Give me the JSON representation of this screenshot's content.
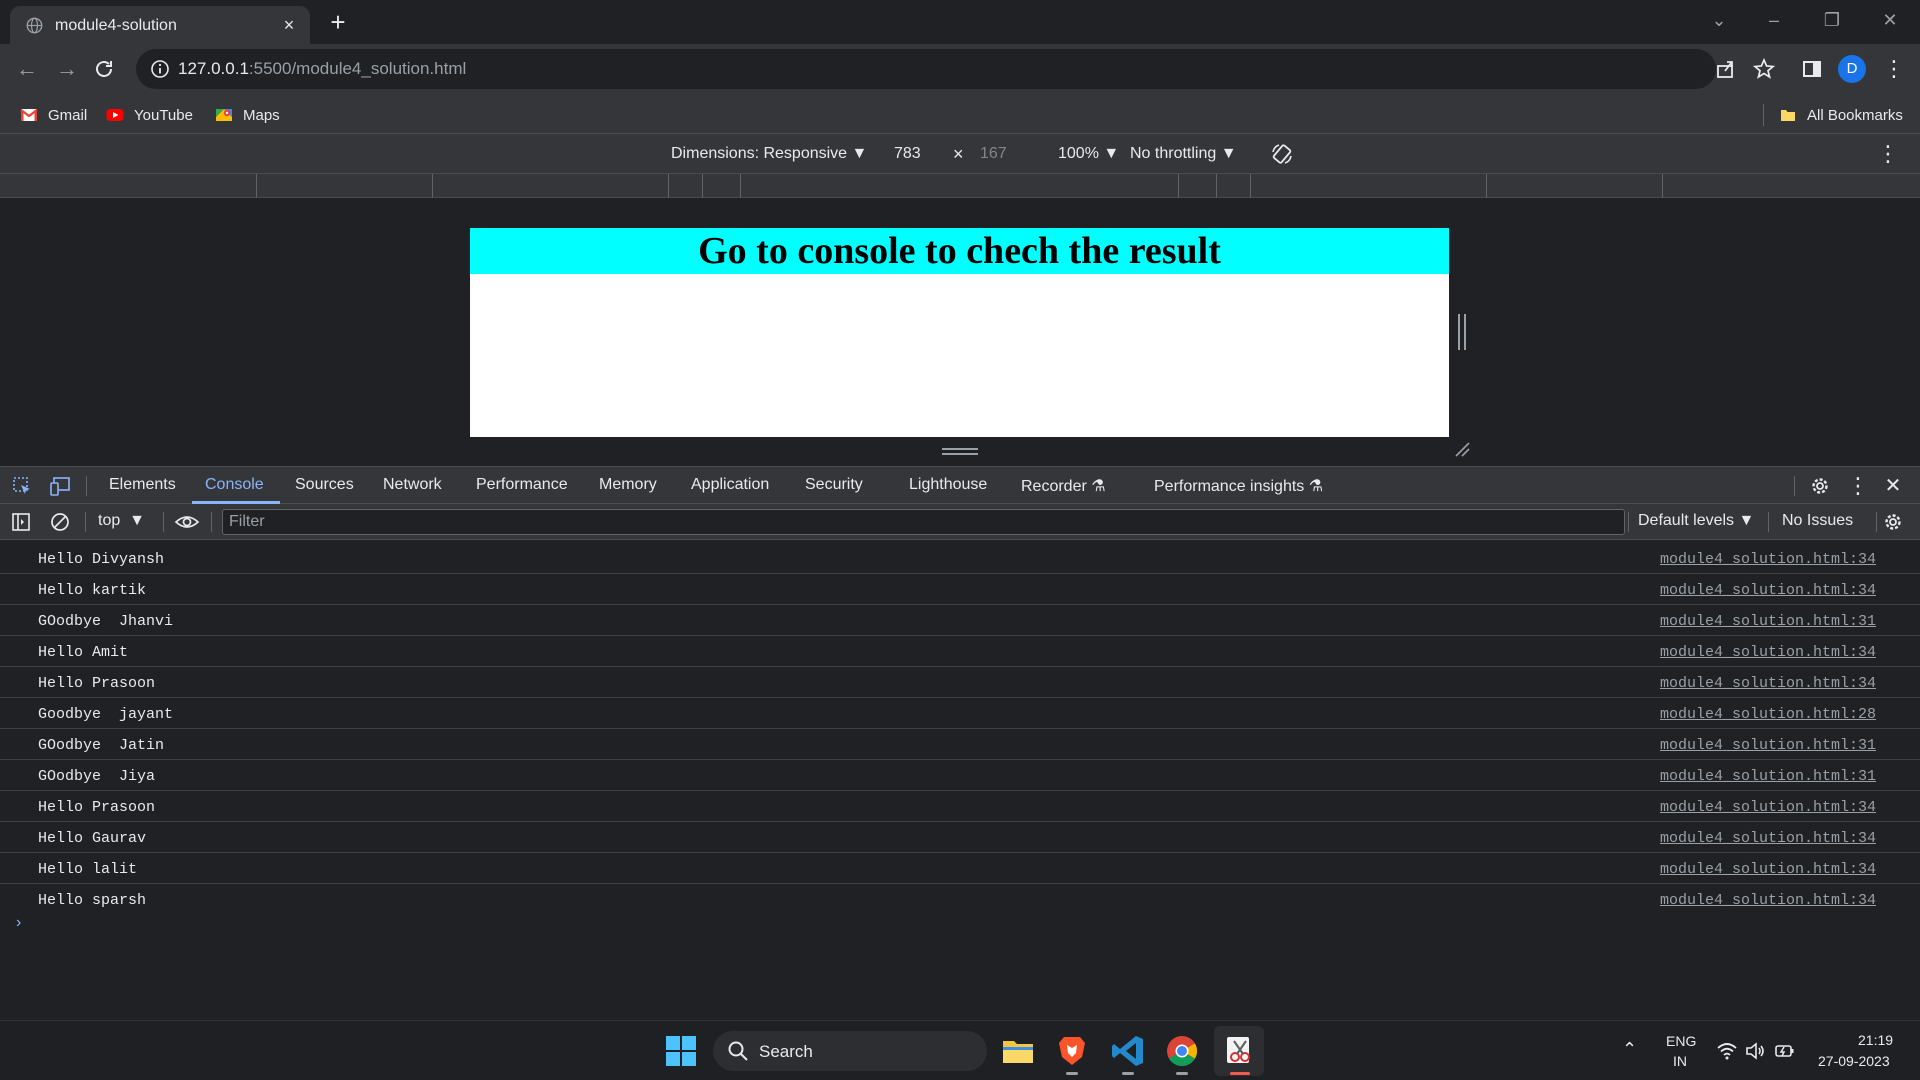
{
  "browser": {
    "tab_title": "module4-solution",
    "tab_close": "×",
    "new_tab": "+",
    "url_host": "127.0.0.1",
    "url_path": ":5500/module4_solution.html",
    "profile_initial": "D",
    "window_controls": [
      "⌄",
      "–",
      "❐",
      "✕"
    ]
  },
  "bookmarks": [
    {
      "label": "Gmail",
      "icon": "gmail-icon"
    },
    {
      "label": "YouTube",
      "icon": "youtube-icon"
    },
    {
      "label": "Maps",
      "icon": "maps-icon"
    }
  ],
  "all_bookmarks": "All Bookmarks",
  "device_toolbar": {
    "dimensions": "Dimensions: Responsive",
    "width": "783",
    "times": "×",
    "height": "167",
    "zoom": "100%",
    "throttling": "No throttling"
  },
  "page": {
    "heading": "Go to console to chech the result"
  },
  "devtools": {
    "tabs": [
      "Elements",
      "Console",
      "Sources",
      "Network",
      "Performance",
      "Memory",
      "Application",
      "Security",
      "Lighthouse",
      "Recorder",
      "Performance insights"
    ],
    "active_tab": "Console",
    "context": "top",
    "filter_placeholder": "Filter",
    "levels": "Default levels",
    "issues": "No Issues"
  },
  "console_messages": [
    {
      "text": "Hello Divyansh",
      "source": "module4_solution.html:34"
    },
    {
      "text": "Hello kartik",
      "source": "module4_solution.html:34"
    },
    {
      "text": "GOodbye  Jhanvi",
      "source": "module4_solution.html:31"
    },
    {
      "text": "Hello Amit",
      "source": "module4_solution.html:34"
    },
    {
      "text": "Hello Prasoon",
      "source": "module4_solution.html:34"
    },
    {
      "text": "Goodbye  jayant",
      "source": "module4_solution.html:28"
    },
    {
      "text": "GOodbye  Jatin",
      "source": "module4_solution.html:31"
    },
    {
      "text": "GOodbye  Jiya",
      "source": "module4_solution.html:31"
    },
    {
      "text": "Hello Prasoon",
      "source": "module4_solution.html:34"
    },
    {
      "text": "Hello Gaurav",
      "source": "module4_solution.html:34"
    },
    {
      "text": "Hello lalit",
      "source": "module4_solution.html:34"
    },
    {
      "text": "Hello sparsh",
      "source": "module4_solution.html:34"
    }
  ],
  "taskbar": {
    "search_label": "Search",
    "lang_top": "ENG",
    "lang_bottom": "IN",
    "time": "21:19",
    "date": "27-09-2023"
  },
  "colors": {
    "heading_bg": "#00ffff",
    "accent": "#8ab4f8",
    "profile": "#1a73e8"
  }
}
